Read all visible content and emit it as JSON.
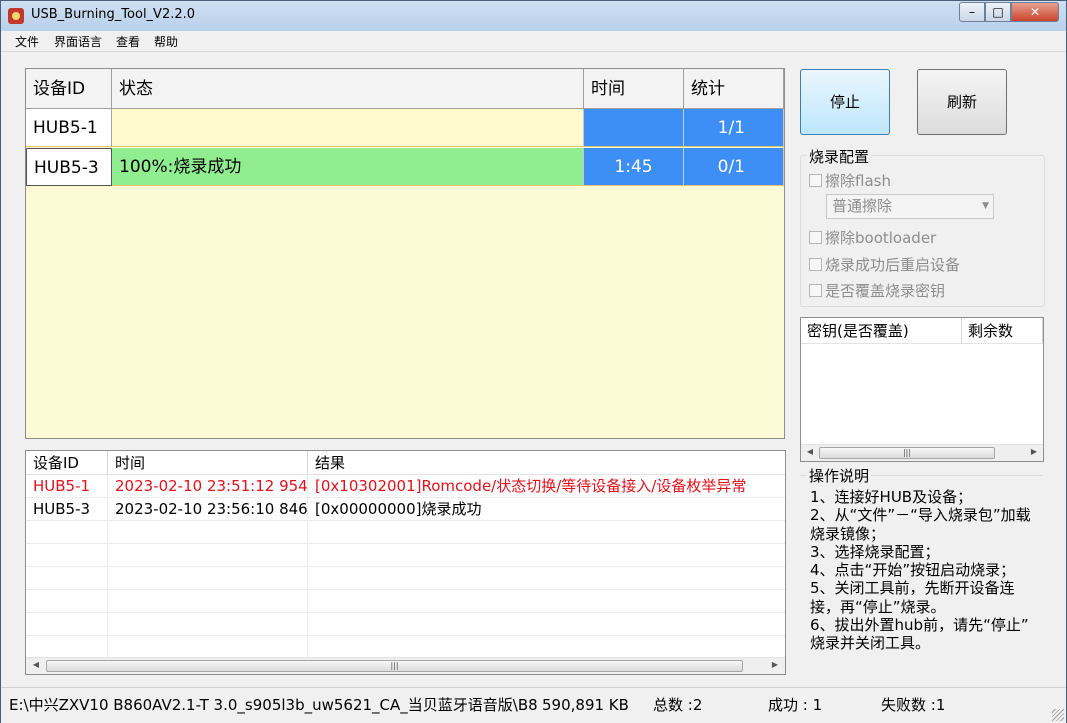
{
  "window": {
    "title": "USB_Burning_Tool_V2.2.0",
    "min": "–",
    "max": "□",
    "close": "✕"
  },
  "menu": [
    "文件",
    "界面语言",
    "查看",
    "帮助"
  ],
  "device_grid": {
    "headers": {
      "id": "设备ID",
      "status": "状态",
      "time": "时间",
      "count": "统计"
    },
    "rows": [
      {
        "id": "HUB5-1",
        "status": "",
        "time": "",
        "count": "1/1"
      },
      {
        "id": "HUB5-3",
        "status": "100%:烧录成功",
        "time": "1:45",
        "count": "0/1"
      }
    ]
  },
  "buttons": {
    "stop": "停止",
    "refresh": "刷新"
  },
  "burn_config": {
    "title": "烧录配置",
    "erase_flash": "擦除flash",
    "erase_mode": "普通擦除",
    "erase_bootloader": "擦除bootloader",
    "reboot_after": "烧录成功后重启设备",
    "overwrite_key": "是否覆盖烧录密钥"
  },
  "key_list": {
    "col_key": "密钥(是否覆盖)",
    "col_remain": "剩余数"
  },
  "instructions": {
    "title": "操作说明",
    "lines": [
      "1、连接好HUB及设备；",
      "2、从“文件”－“导入烧录包”加载",
      "烧录镜像；",
      "3、选择烧录配置；",
      "4、点击“开始”按钮启动烧录；",
      "5、关闭工具前，先断开设备连",
      "接，再“停止”烧录。",
      "6、拔出外置hub前，请先“停止”",
      "烧录并关闭工具。"
    ]
  },
  "log": {
    "headers": {
      "id": "设备ID",
      "time": "时间",
      "result": "结果"
    },
    "rows": [
      {
        "id": "HUB5-1",
        "time": "2023-02-10 23:51:12 954",
        "result": "[0x10302001]Romcode/状态切换/等待设备接入/设备枚举异常",
        "error": true
      },
      {
        "id": "HUB5-3",
        "time": "2023-02-10 23:56:10 846",
        "result": "[0x00000000]烧录成功",
        "error": false
      }
    ]
  },
  "statusbar": {
    "path": "E:\\中兴ZXV10 B860AV2.1-T 3.0_s905l3b_uw5621_CA_当贝蓝牙语音版\\B8",
    "size": "590,891 KB",
    "total": "总数 :2",
    "success": "成功 : 1",
    "fail": "失败数 :1"
  },
  "colors": {
    "blue_cell": "#3d8ef5",
    "green_cell": "#90ee90",
    "grid_bg": "#fdfbd6",
    "error_text": "#e0121b"
  }
}
